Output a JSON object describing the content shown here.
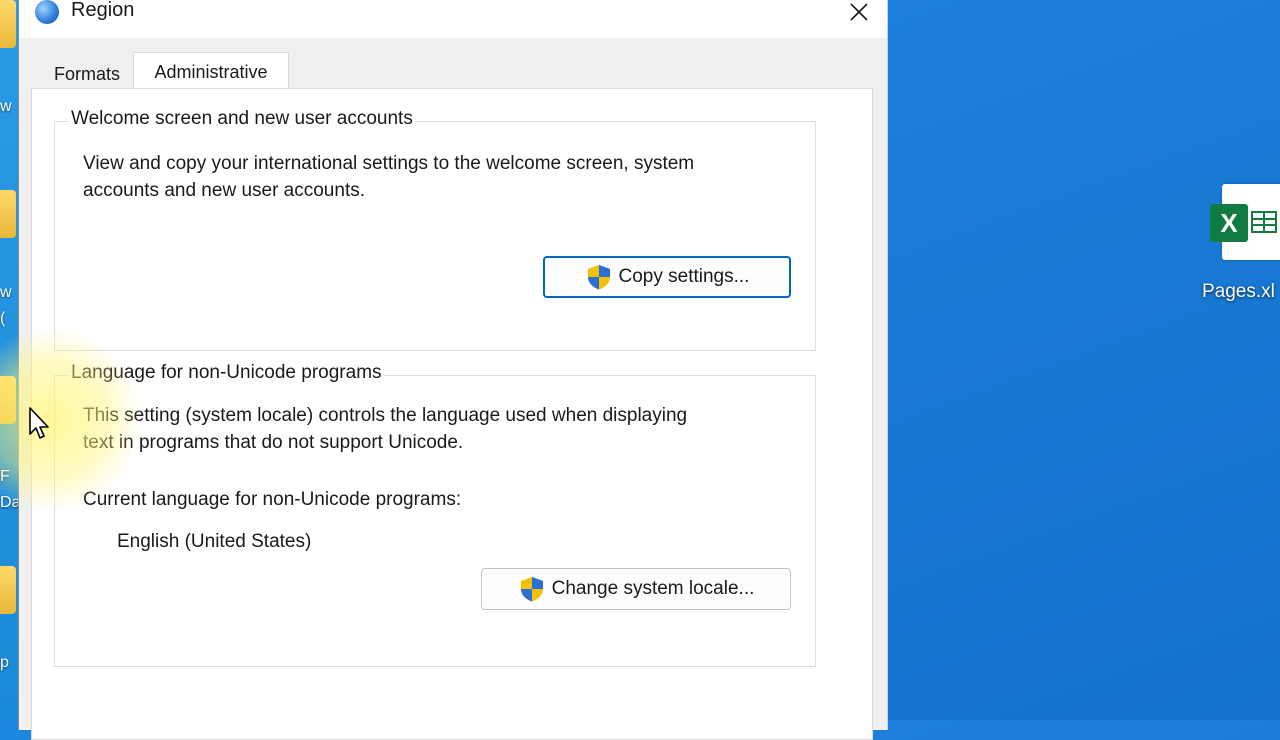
{
  "window": {
    "title": "Region",
    "close_label": "Close"
  },
  "tabs": [
    {
      "label": "Formats",
      "active": false
    },
    {
      "label": "Administrative",
      "active": true
    }
  ],
  "welcome_group": {
    "legend": "Welcome screen and new user accounts",
    "description_line1": "View and copy your international settings to the welcome screen, system",
    "description_line2": "accounts and new user accounts.",
    "button_label": "Copy settings..."
  },
  "unicode_group": {
    "legend": "Language for non-Unicode programs",
    "description_line1": "This setting (system locale) controls the language used when displaying",
    "description_line2": "text in programs that do not support Unicode.",
    "current_label": "Current language for non-Unicode programs:",
    "current_value": "English (United States)",
    "button_label": "Change system locale..."
  },
  "desktop": {
    "file_label": "Pages.xl",
    "file_icon_letter": "X",
    "left_fragments": [
      "w",
      "w",
      "(",
      "F",
      "Da",
      "p"
    ]
  },
  "colors": {
    "desktop_blue": "#1a7bd6",
    "focus_blue": "#0067c0",
    "excel_green": "#107c41"
  }
}
